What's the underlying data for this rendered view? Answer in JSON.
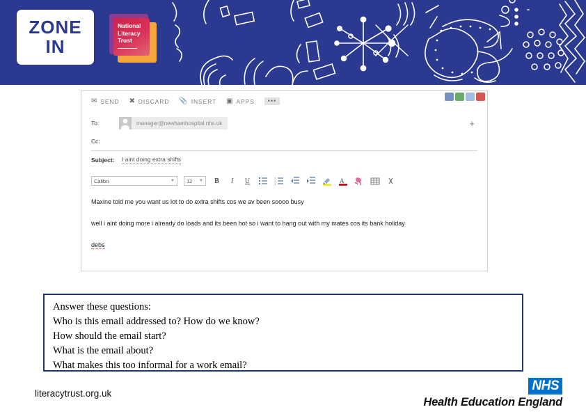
{
  "banner": {
    "zone_in": {
      "line1": "ZONE",
      "line2": "IN"
    },
    "nlt_logo": {
      "line1": "National",
      "line2": "Literacy",
      "line3": "Trust"
    },
    "background_color": "#2b3990",
    "doodle_color": "#ffffff"
  },
  "email": {
    "toolbar": [
      {
        "icon": "send-icon",
        "label": "SEND"
      },
      {
        "icon": "discard-icon",
        "label": "DISCARD"
      },
      {
        "icon": "insert-icon",
        "label": "INSERT"
      },
      {
        "icon": "apps-icon",
        "label": "APPS"
      }
    ],
    "more_label": "•••",
    "window_icons": [
      "#5b7fb5",
      "#4e9d52",
      "#8fb3d9",
      "#cf3a32"
    ],
    "to": {
      "label": "To:",
      "recipient": "manager@newhamhospital.nhs.uk",
      "add_label": "+"
    },
    "cc": {
      "label": "Cc:",
      "value": ""
    },
    "subject": {
      "label": "Subject:",
      "value": "I aint doing extra shifts"
    },
    "format_toolbar": {
      "font_name": "Calibri",
      "font_size": "12",
      "bold": "B",
      "italic": "I",
      "underline": "U",
      "bullets_icon": "bulleted-list-icon",
      "numbering_icon": "numbered-list-icon",
      "indent_icon": "increase-indent-icon",
      "outdent_icon": "decrease-indent-icon",
      "highlight_icon": "highlight-color-icon",
      "fontcolor_icon": "font-color-icon",
      "fontcolor_letter": "A",
      "painter_icon": "format-painter-icon",
      "table_icon": "insert-table-icon",
      "more_icon": "more-formatting-icon",
      "highlight_color": "#ffe400",
      "fontcolor_color": "#c00000"
    },
    "body": {
      "line1": "Maxine told me you want us lot to do extra shifts cos we av been soooo busy",
      "line2": "well i aint doing more i already do loads and its been hot so i want to hang out with my mates cos its bank holiday",
      "line3": "debs"
    }
  },
  "questions": {
    "heading": "Answer these questions:",
    "items": [
      "Who is this email addressed to? How do we know?",
      "How should the email start?",
      "What is the email about?",
      "What makes this too informal for a work email?"
    ],
    "border_color": "#1f3864"
  },
  "footer": {
    "url": "literacytrust.org.uk",
    "nhs_label": "NHS",
    "organisation": "Health Education England",
    "nhs_color": "#0072ce"
  }
}
